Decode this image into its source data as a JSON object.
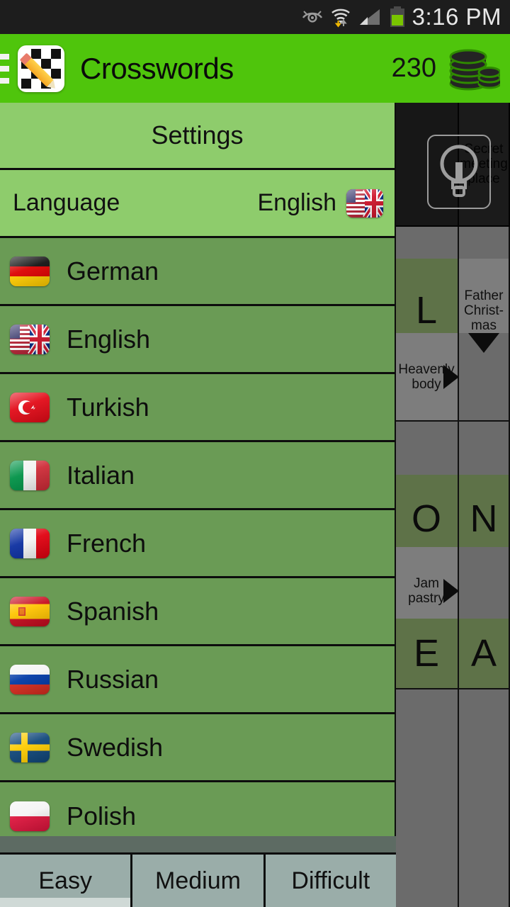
{
  "statusbar": {
    "time": "3:16 PM",
    "icons": [
      "smart-stay-eye-icon",
      "wifi-icon",
      "cellular-signal-icon",
      "battery-icon"
    ]
  },
  "appbar": {
    "menu_icon": "hamburger-menu-icon",
    "app_icon": "crossword-app-icon",
    "title": "Crosswords",
    "coin_count": "230",
    "coins_icon": "coins-icon",
    "background_color": "#4fc50c"
  },
  "settings_panel": {
    "header_title": "Settings",
    "header_color": "#8ecc6c",
    "row_color": "#6a9b55",
    "current": {
      "label": "Language",
      "value": "English",
      "flag": "flag-us-uk"
    },
    "languages": [
      {
        "name": "German",
        "flag": "flag-de"
      },
      {
        "name": "English",
        "flag": "flag-us-uk"
      },
      {
        "name": "Turkish",
        "flag": "flag-tr"
      },
      {
        "name": "Italian",
        "flag": "flag-it"
      },
      {
        "name": "French",
        "flag": "flag-fr"
      },
      {
        "name": "Spanish",
        "flag": "flag-es"
      },
      {
        "name": "Russian",
        "flag": "flag-ru"
      },
      {
        "name": "Swedish",
        "flag": "flag-se"
      },
      {
        "name": "Polish",
        "flag": "flag-pl"
      }
    ]
  },
  "difficulty_tabs": {
    "items": [
      {
        "label": "Easy",
        "selected": true
      },
      {
        "label": "Medium",
        "selected": false
      },
      {
        "label": "Difficult",
        "selected": false
      }
    ],
    "selected_indicator_color": "#cfd9d6"
  },
  "crossword": {
    "hint_button_icon": "lightbulb-hint-icon",
    "clues": [
      {
        "text": "Secret meeting place"
      },
      {
        "text": "Father Christ-mas"
      },
      {
        "text": "Heavenly body"
      },
      {
        "text": "Jam pastry"
      }
    ],
    "letters": [
      "L",
      "O",
      "N",
      "E",
      "A"
    ],
    "letter_cell_color": "#5e7248",
    "clue_cell_color": "#7d7d7d",
    "empty_cell_color": "#6b6b6b"
  }
}
